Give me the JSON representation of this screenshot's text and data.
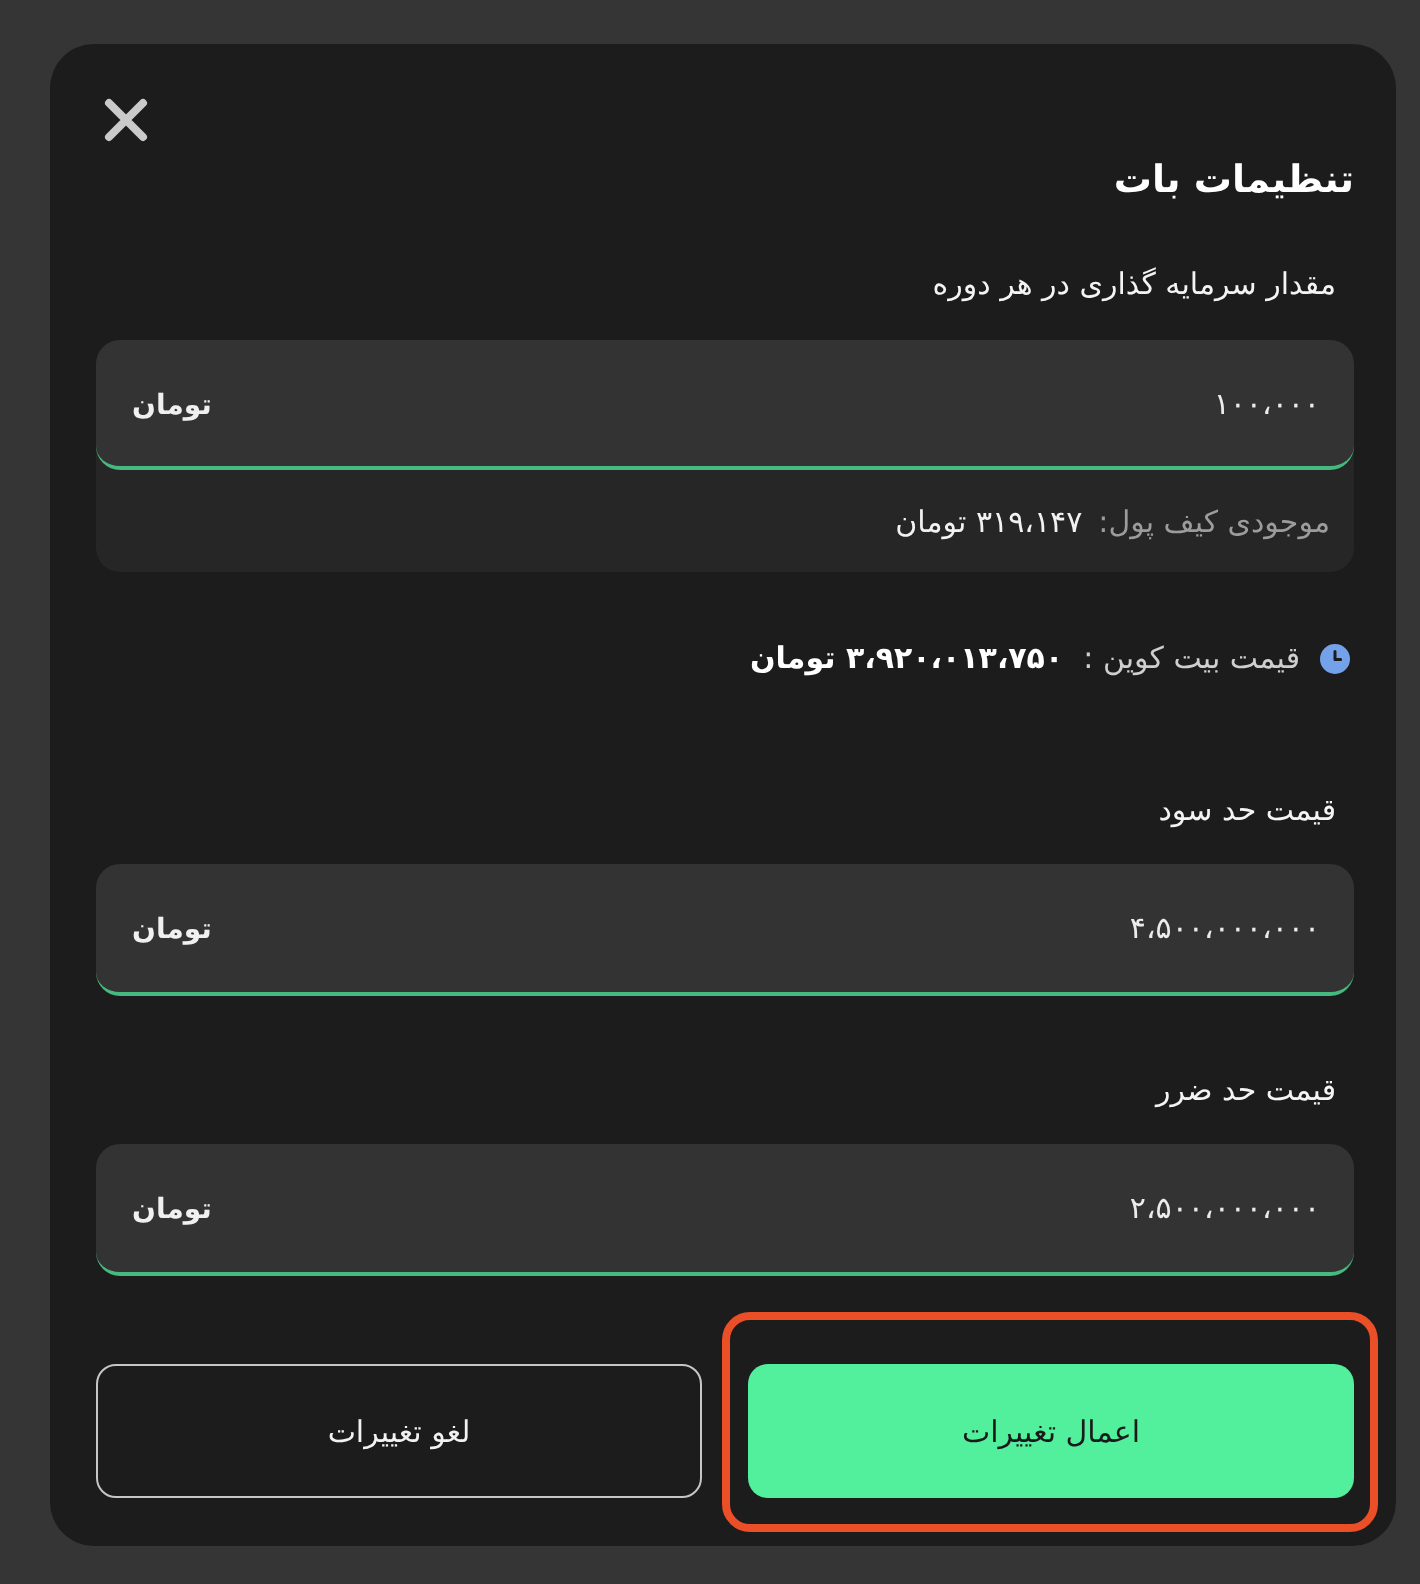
{
  "dialog": {
    "title": "تنظیمات بات"
  },
  "investment": {
    "label": "مقدار سرمایه گذاری در هر دوره",
    "value": "۱۰۰،۰۰۰",
    "unit": "تومان",
    "wallet_balance": {
      "label": "موجودی کیف پول:",
      "value": "۳۱۹،۱۴۷ تومان"
    }
  },
  "bitcoin_price": {
    "label": "قیمت بیت کوین :",
    "value": "۳،۹۲۰،۰۱۳،۷۵۰ تومان"
  },
  "take_profit": {
    "label": "قیمت حد سود",
    "value": "۴،۵۰۰،۰۰۰،۰۰۰",
    "unit": "تومان"
  },
  "stop_loss": {
    "label": "قیمت حد ضرر",
    "value": "۲،۵۰۰،۰۰۰،۰۰۰",
    "unit": "تومان"
  },
  "buttons": [
    {
      "kind": "primary",
      "label": "اعمال تغییرات",
      "highlighted": true
    },
    {
      "kind": "secondary",
      "label": "لغو تغییرات",
      "highlighted": false
    }
  ]
}
